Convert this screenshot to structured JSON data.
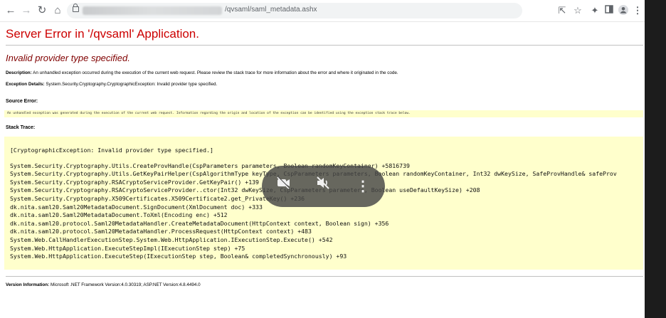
{
  "browser": {
    "url_visible": "/qvsaml/saml_metadata.ashx",
    "icons": [
      "back-arrow-icon",
      "forward-arrow-icon",
      "reload-icon",
      "home-icon",
      "lock-icon",
      "share-icon",
      "star-icon",
      "extensions-icon",
      "sidebar-icon",
      "profile-icon",
      "menu-kebab-icon"
    ]
  },
  "page": {
    "title": "Server Error in '/qvsaml' Application.",
    "subtitle": "Invalid provider type specified.",
    "description_label": "Description:",
    "description_text": "An unhandled exception occurred during the execution of the current web request. Please review the stack trace for more information about the error and where it originated in the code.",
    "exception_label": "Exception Details:",
    "exception_text": "System.Security.Cryptography.CryptographicException: Invalid provider type specified.",
    "source_label": "Source Error:",
    "source_text": "An unhandled exception was generated during the execution of the current web request. Information regarding the origin and location of the exception can be identified using the exception stack trace below.",
    "stack_label": "Stack Trace:",
    "stack_lines": [
      "[CryptographicException: Invalid provider type specified.]",
      "   System.Security.Cryptography.Utils.CreateProvHandle(CspParameters parameters, Boolean randomKeyContainer) +5816739",
      "   System.Security.Cryptography.Utils.GetKeyPairHelper(CspAlgorithmType keyType, CspParameters parameters, Boolean randomKeyContainer, Int32 dwKeySize, SafeProvHandle& safeProv",
      "   System.Security.Cryptography.RSACryptoServiceProvider.GetKeyPair() +139",
      "   System.Security.Cryptography.RSACryptoServiceProvider..ctor(Int32 dwKeySize, CspParameters parameters, Boolean useDefaultKeySize) +208",
      "   System.Security.Cryptography.X509Certificates.X509Certificate2.get_PrivateKey() +236",
      "   dk.nita.saml20.Saml20MetadataDocument.SignDocument(XmlDocument doc) +333",
      "   dk.nita.saml20.Saml20MetadataDocument.ToXml(Encoding enc) +512",
      "   dk.nita.saml20.protocol.Saml20MetadataHandler.CreateMetadataDocument(HttpContext context, Boolean sign) +356",
      "   dk.nita.saml20.protocol.Saml20MetadataHandler.ProcessRequest(HttpContext context) +483",
      "   System.Web.CallHandlerExecutionStep.System.Web.HttpApplication.IExecutionStep.Execute() +542",
      "   System.Web.HttpApplication.ExecuteStepImpl(IExecutionStep step) +75",
      "   System.Web.HttpApplication.ExecuteStep(IExecutionStep step, Boolean& completedSynchronously) +93"
    ],
    "version_label": "Version Information:",
    "version_text": "Microsoft .NET Framework Version:4.0.30319; ASP.NET Version:4.8.4494.0"
  },
  "overlay": {
    "icons": [
      "video-off-icon",
      "mute-icon",
      "more-options-icon"
    ]
  },
  "colors": {
    "title": "#cc0000",
    "subtitle": "#800000",
    "code_background": "#ffffcc"
  }
}
